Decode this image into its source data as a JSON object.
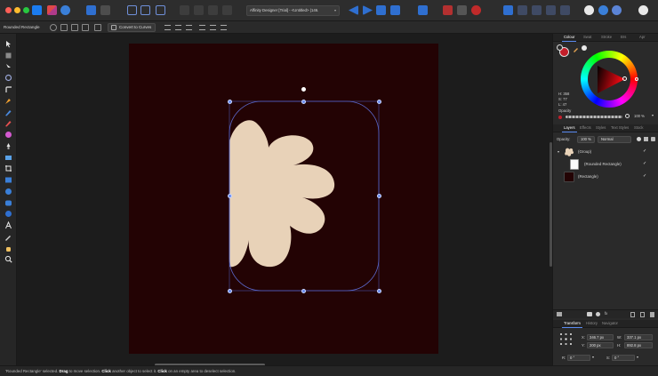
{
  "app": {
    "document_title": "Affinity Designer [Trial] - <Untitled> (146.",
    "title_chevron": "▾"
  },
  "context_toolbar": {
    "selection_label": "Rounded Rectangle",
    "convert_button": "Convert to Curves"
  },
  "colors": {
    "accent": "#5a8af0",
    "artboard": "#230304",
    "shape_fill": "#e8d2b8",
    "swatch": "#c41e2a",
    "selection": "#6a8cf0"
  },
  "color_panel": {
    "tabs": [
      "Colour",
      "Swat",
      "Stroke",
      "Brs",
      "Apr"
    ],
    "hsl": {
      "h": "H: 358",
      "s": "S: 77",
      "l": "L: 47"
    },
    "opacity_label": "Opacity",
    "opacity_value": "100 %"
  },
  "layers_panel": {
    "tabs": [
      "Layers",
      "Effects",
      "Styles",
      "Text Styles",
      "Stock"
    ],
    "opacity_label": "Opacity:",
    "opacity_value": "100 %",
    "blend_mode": "Normal",
    "layers": [
      {
        "name": "(Group)",
        "check": "✓"
      },
      {
        "name": "(Rounded Rectangle)",
        "check": "✓"
      },
      {
        "name": "(Rectangle)",
        "check": "✓"
      }
    ]
  },
  "transform_panel": {
    "tabs": [
      "Transform",
      "History",
      "Navigator"
    ],
    "x_label": "X:",
    "x_value": "346.7 px",
    "w_label": "W:",
    "w_value": "337.1 px",
    "y_label": "Y:",
    "y_value": "200 px",
    "h_label": "H:",
    "h_value": "892.8 px",
    "r_label": "R:",
    "r_value": "0 °",
    "s_label": "S:",
    "s_value": "0 °"
  },
  "status": {
    "quoted": "'Rounded Rectangle' selected. ",
    "b1": "Drag",
    "t1": " to move selection. ",
    "b2": "Click",
    "t2": " another object to select it. ",
    "b3": "Click",
    "t3": " on an empty area to deselect selection."
  }
}
